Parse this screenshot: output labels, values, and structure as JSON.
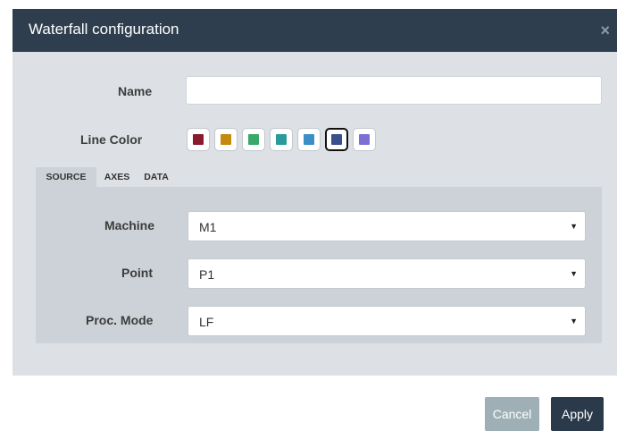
{
  "dialog": {
    "title": "Waterfall configuration",
    "close_glyph": "×"
  },
  "form": {
    "name_label": "Name",
    "name_value": "",
    "name_placeholder": "",
    "line_color_label": "Line Color",
    "colors": [
      {
        "hex": "#8b1a2e",
        "selected": false
      },
      {
        "hex": "#c48a0c",
        "selected": false
      },
      {
        "hex": "#39a86a",
        "selected": false
      },
      {
        "hex": "#2b9a9a",
        "selected": false
      },
      {
        "hex": "#3b8fc6",
        "selected": false
      },
      {
        "hex": "#3b4e8e",
        "selected": true
      },
      {
        "hex": "#7b6fd6",
        "selected": false
      }
    ]
  },
  "tabs": [
    {
      "label": "SOURCE",
      "active": true
    },
    {
      "label": "AXES",
      "active": false
    },
    {
      "label": "DATA",
      "active": false
    }
  ],
  "source": {
    "machine_label": "Machine",
    "machine_value": "M1",
    "point_label": "Point",
    "point_value": "P1",
    "proc_mode_label": "Proc. Mode",
    "proc_mode_value": "LF",
    "caret_glyph": "▼"
  },
  "footer": {
    "cancel_label": "Cancel",
    "apply_label": "Apply"
  },
  "theme": {
    "header_bg": "#2f3e4e",
    "body_bg": "#dde1e5",
    "panel_bg": "#ccd2d7",
    "apply_bg": "#2b3a4b",
    "cancel_bg": "#9eb0b6"
  }
}
